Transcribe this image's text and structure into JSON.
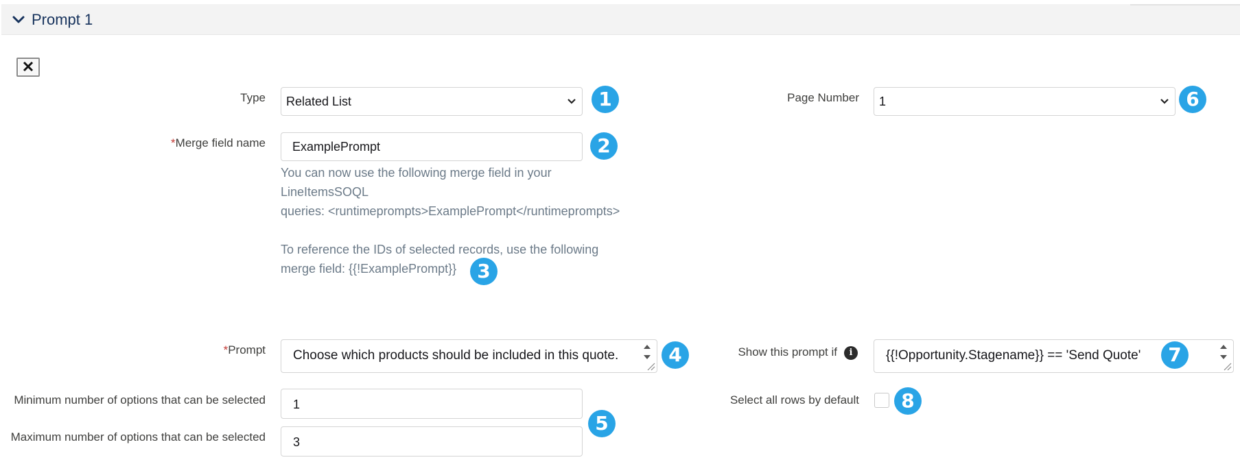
{
  "section": {
    "title": "Prompt 1"
  },
  "labels": {
    "type": "Type",
    "merge_field_required": "*",
    "merge_field": "Merge field name",
    "prompt_required": "*",
    "prompt": "Prompt",
    "min_options": "Minimum number of options that can be selected",
    "max_options": "Maximum number of options that can be selected",
    "page_number": "Page Number",
    "show_if": "Show this prompt if",
    "select_all": "Select all rows by default"
  },
  "fields": {
    "type_value": "Related List",
    "merge_field_value": "ExamplePrompt",
    "prompt_value": "Choose which products should be included in this quote.",
    "min_value": "1",
    "max_value": "3",
    "page_number_value": "1",
    "show_if_value": "{{!Opportunity.Stagename}} == 'Send Quote'",
    "select_all_checked": false
  },
  "help": {
    "line1": "You can now use the following merge field in your",
    "line2": "LineItemsSOQL",
    "line3": "queries: <runtimeprompts>ExamplePrompt</runtimeprompts>",
    "line4": "To reference the IDs of selected records, use the following",
    "line5": "merge field: {{!ExamplePrompt}}"
  },
  "badges": [
    "1",
    "2",
    "3",
    "4",
    "5",
    "6",
    "7",
    "8"
  ],
  "colors": {
    "badge": "#29a4e6",
    "required": "#c23934",
    "help_text": "#6b7a88",
    "header_bg": "#f3f3f3"
  }
}
